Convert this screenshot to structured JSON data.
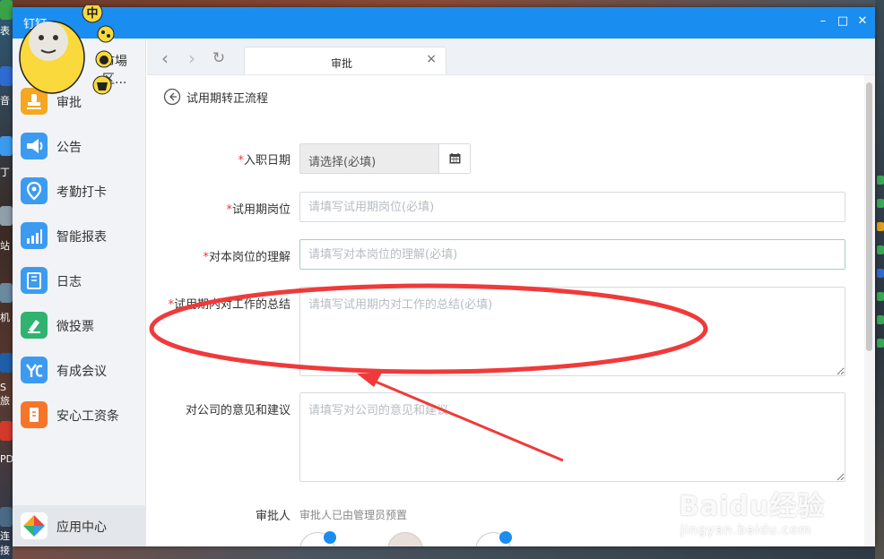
{
  "window": {
    "app_name": "钉钉"
  },
  "desktop": {
    "left_labels": [
      "表",
      "音",
      "丁",
      "站",
      "机",
      "S 旅",
      "PD",
      "连接"
    ]
  },
  "sidebar": {
    "items": [
      {
        "label": "审批",
        "icon": "approval-icon",
        "color": "#f5a623"
      },
      {
        "label": "公告",
        "icon": "megaphone-icon",
        "color": "#3c9bf0"
      },
      {
        "label": "考勤打卡",
        "icon": "location-pin-icon",
        "color": "#3c9bf0"
      },
      {
        "label": "智能报表",
        "icon": "bar-chart-icon",
        "color": "#3c9bf0"
      },
      {
        "label": "日志",
        "icon": "notebook-icon",
        "color": "#3c9bf0"
      },
      {
        "label": "微投票",
        "icon": "vote-icon",
        "color": "#2fb36f"
      },
      {
        "label": "有成会议",
        "icon": "meeting-icon",
        "color": "#3c9bf0"
      },
      {
        "label": "安心工资条",
        "icon": "salary-icon",
        "color": "#f5762a"
      }
    ],
    "partial_item": "市場区...",
    "app_center": {
      "label": "应用中心",
      "icon": "app-center-icon"
    }
  },
  "tab": {
    "label": "审批",
    "close": "×"
  },
  "page": {
    "title": "试用期转正流程"
  },
  "form": {
    "required_mark": "*",
    "hire_date": {
      "label": "入职日期",
      "placeholder": "请选择(必填)"
    },
    "probation_post": {
      "label": "试用期岗位",
      "placeholder": "请填写试用期岗位(必填)"
    },
    "post_understanding": {
      "label": "对本岗位的理解",
      "placeholder": "请填写对本岗位的理解(必填)"
    },
    "work_summary": {
      "label": "试用期内对工作的总结",
      "placeholder": "请填写试用期内对工作的总结(必填)"
    },
    "suggestions": {
      "label": "对公司的意见和建议",
      "placeholder": "请填写对公司的意见和建议"
    },
    "approver": {
      "label": "审批人",
      "note": "审批人已由管理员预置"
    }
  },
  "colors": {
    "titlebar": "#1a8ef0",
    "required": "#e63b3b",
    "annotation": "#f03a3a"
  },
  "watermark": {
    "logo": "Baidu经验",
    "url": "jingyan.baidu.com"
  }
}
